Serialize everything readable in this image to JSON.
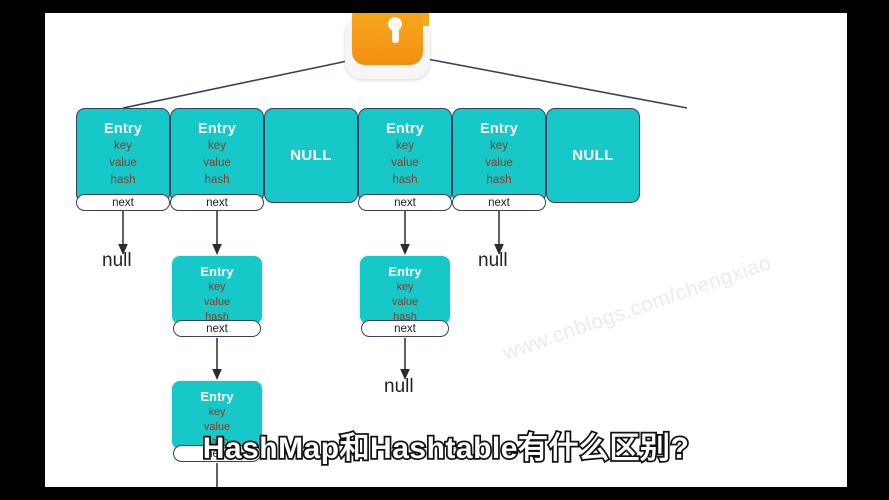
{
  "frame": {
    "letterbox_color": "#000000",
    "canvas_color": "#ffffff"
  },
  "diagram": {
    "title_icon": "lock-icon",
    "accent_color": "#17c8c8",
    "field_text_color": "#8a3a24",
    "stroke_color": "#3a3f5c",
    "entry_label": "Entry",
    "field_key": "key",
    "field_value": "value",
    "field_hash": "hash",
    "next_label": "next",
    "null_box_label": "NULL",
    "null_text": "null",
    "buckets": [
      {
        "type": "entry",
        "title": "Entry",
        "fields": [
          "key",
          "value",
          "hash"
        ],
        "next": "next"
      },
      {
        "type": "entry",
        "title": "Entry",
        "fields": [
          "key",
          "value",
          "hash"
        ],
        "next": "next"
      },
      {
        "type": "null",
        "title": "NULL",
        "fields": [],
        "next": ""
      },
      {
        "type": "entry",
        "title": "Entry",
        "fields": [
          "key",
          "value",
          "hash"
        ],
        "next": "next"
      },
      {
        "type": "entry",
        "title": "Entry",
        "fields": [
          "key",
          "value",
          "hash"
        ],
        "next": "next"
      },
      {
        "type": "null",
        "title": "NULL",
        "fields": [],
        "next": ""
      }
    ],
    "chain_nodes": [
      {
        "id": "chain-a1",
        "title": "Entry",
        "fields": [
          "key",
          "value",
          "hash"
        ],
        "next": "next"
      },
      {
        "id": "chain-a2",
        "title": "Entry",
        "fields": [
          "key",
          "value",
          "hash"
        ],
        "next": "next"
      },
      {
        "id": "chain-b1",
        "title": "Entry",
        "fields": [
          "key",
          "value",
          "hash"
        ],
        "next": "next"
      }
    ],
    "null_terminators": [
      "null",
      "null",
      "null"
    ]
  },
  "watermark": {
    "text": "www.cnblogs.com/chengxiao"
  },
  "subtitle": {
    "text": "HashMap和Hashtable有什么区别?"
  }
}
